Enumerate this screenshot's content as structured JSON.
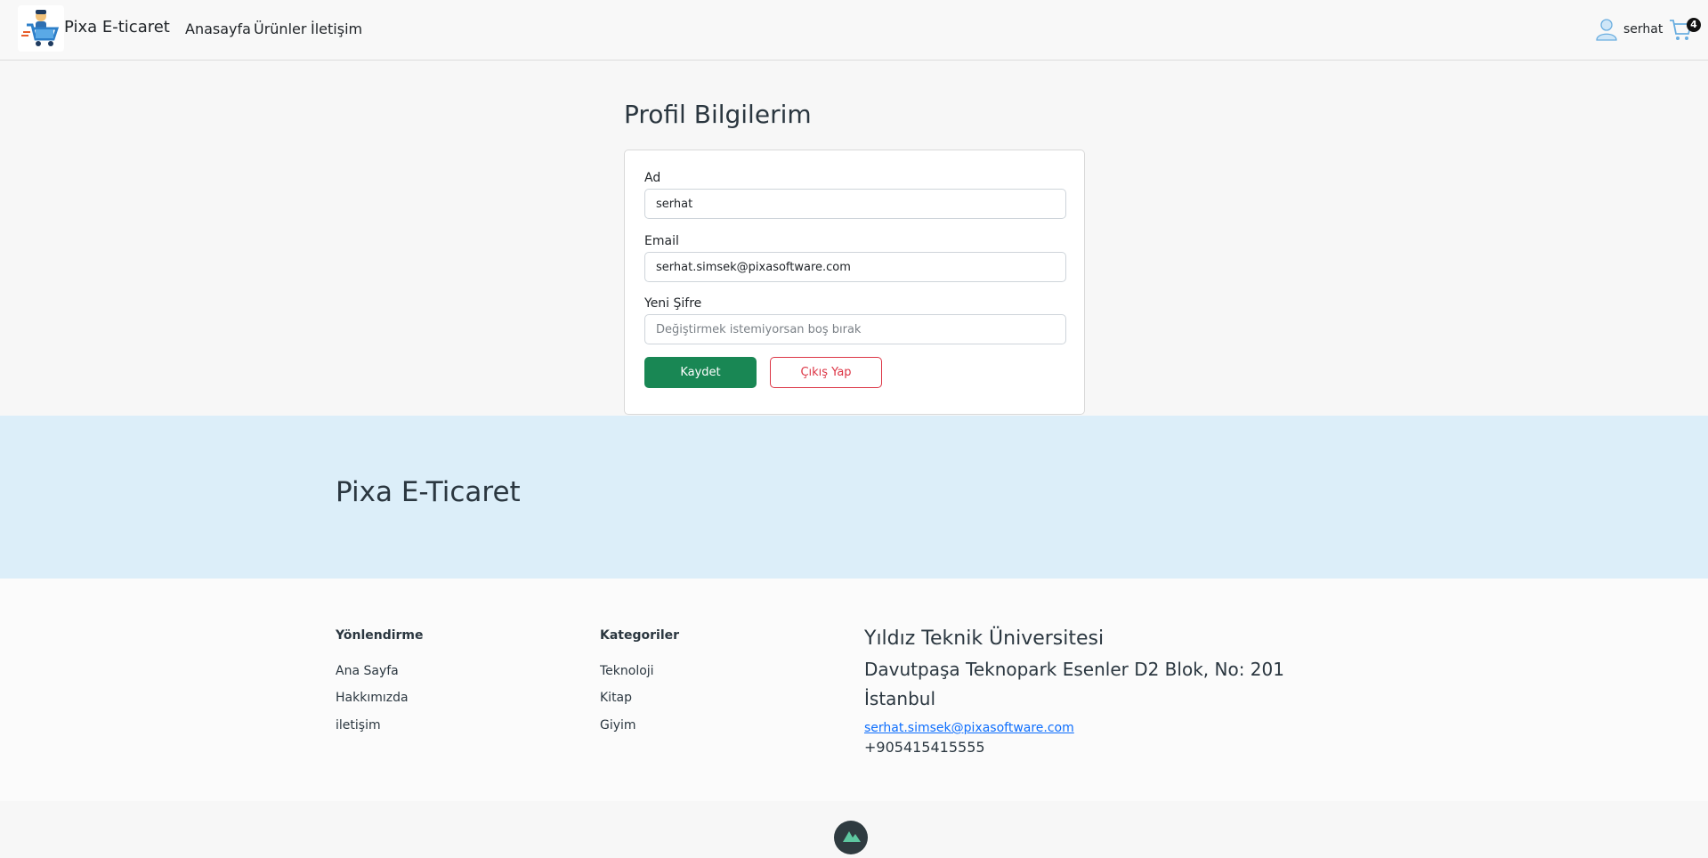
{
  "header": {
    "brand": "Pixa E-ticaret",
    "nav": [
      "Anasayfa",
      "Ürünler",
      "İletişim"
    ],
    "user_name": "serhat",
    "cart_count": "4"
  },
  "profile": {
    "title": "Profil Bilgilerim",
    "name_label": "Ad",
    "name_value": "serhat",
    "email_label": "Email",
    "email_value": "serhat.simsek@pixasoftware.com",
    "password_label": "Yeni Şifre",
    "password_placeholder": "Değiştirmek istemiyorsan boş bırak",
    "save_label": "Kaydet",
    "logout_label": "Çıkış Yap"
  },
  "banner": {
    "title": "Pixa E-Ticaret"
  },
  "footer": {
    "col1_title": "Yönlendirme",
    "col1_links": [
      "Ana Sayfa",
      "Hakkımızda",
      "iletişim"
    ],
    "col2_title": "Kategoriler",
    "col2_links": [
      "Teknoloji",
      "Kitap",
      "Giyim"
    ],
    "address": [
      "Yıldız Teknik Üniversitesi",
      "Davutpaşa Teknopark Esenler D2 Blok, No: 201",
      "İstanbul"
    ],
    "email": "serhat.simsek@pixasoftware.com",
    "phone": "+905415415555"
  },
  "colors": {
    "save": "#198754",
    "logout": "#dc3545",
    "banner": "#dceef9",
    "link": "#0d6efd"
  }
}
